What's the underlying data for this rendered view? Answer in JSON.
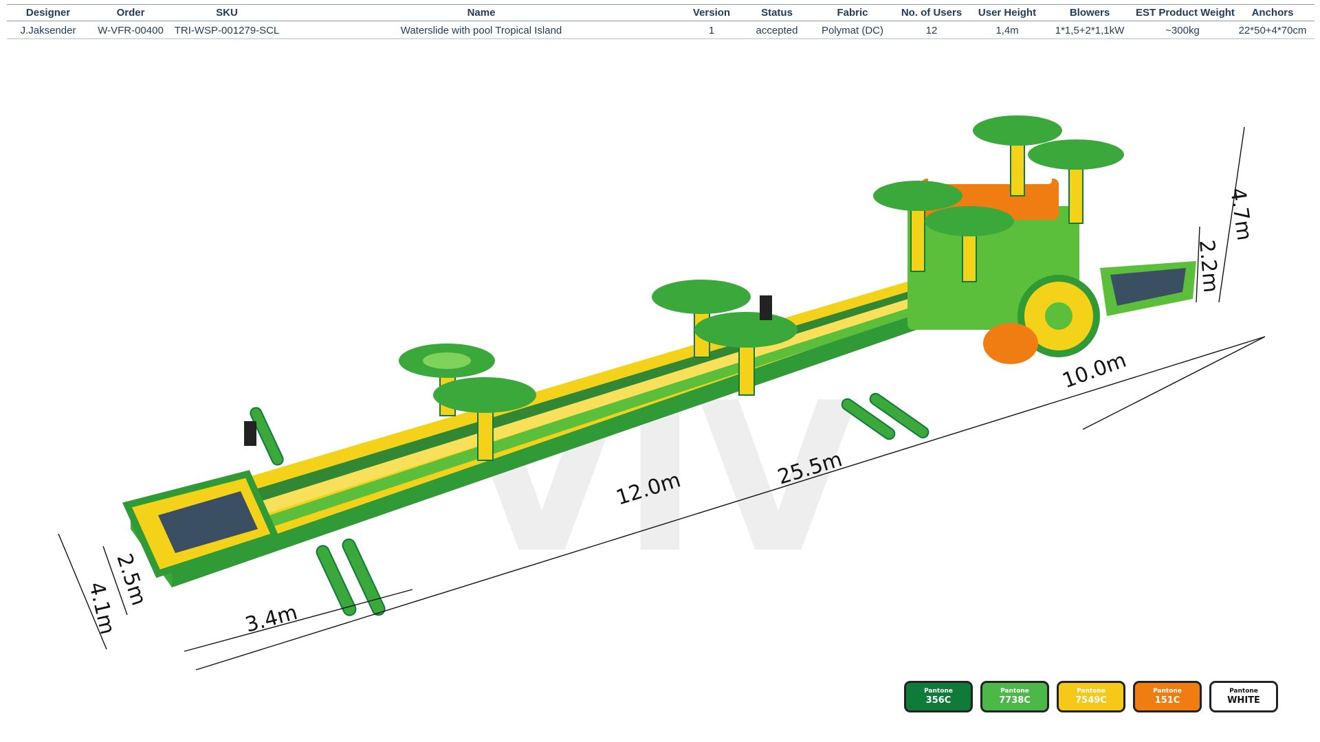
{
  "spec_table": {
    "headers": [
      "Designer",
      "Order",
      "SKU",
      "Name",
      "Version",
      "Status",
      "Fabric",
      "No. of Users",
      "User  Height",
      "Blowers",
      "EST Product Weight",
      "Anchors"
    ],
    "row": [
      "J.Jaksender",
      "W-VFR-00400",
      "TRI-WSP-001279-SCL",
      "Waterslide with pool Tropical Island",
      "1",
      "accepted",
      "Polymat (DC)",
      "12",
      "1,4m",
      "1*1,5+2*1,1kW",
      "~300kg",
      "22*50+4*70cm"
    ]
  },
  "dimensions": {
    "width_total": "4.1m",
    "width_pool": "2.5m",
    "pool_length": "3.4m",
    "slide_run": "12.0m",
    "total_length": "25.5m",
    "base_length": "10.0m",
    "height_total": "4.7m",
    "platform_height": "2.2m"
  },
  "watermark": "VIV",
  "colors": {
    "green_dark": "#0f7a3a",
    "green_light": "#5cbf3c",
    "yellow": "#f5d21a",
    "orange": "#f07d12",
    "white": "#ffffff"
  },
  "swatches": [
    {
      "brand": "Pantone",
      "code": "356C",
      "color": "#0f7a3a"
    },
    {
      "brand": "Pantone",
      "code": "7738C",
      "color": "#4cb848"
    },
    {
      "brand": "Pantone",
      "code": "7549C",
      "color": "#f6c81a"
    },
    {
      "brand": "Pantone",
      "code": "151C",
      "color": "#f07d12"
    },
    {
      "brand": "Pantone",
      "code": "WHITE",
      "color": "#ffffff"
    }
  ]
}
